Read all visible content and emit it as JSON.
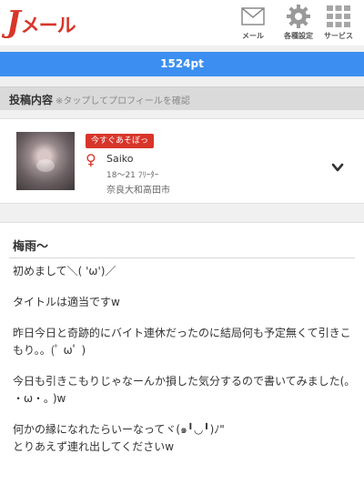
{
  "header": {
    "logo_j": "J",
    "logo_rest": "メール",
    "nav": [
      {
        "label": "メール",
        "icon": "mail-icon"
      },
      {
        "label": "各種設定",
        "icon": "gear-icon"
      },
      {
        "label": "サービス",
        "icon": "grid-icon"
      }
    ]
  },
  "points": "1524pt",
  "section": {
    "title": "投稿内容",
    "note": "※タップしてプロフィールを確認"
  },
  "profile": {
    "badge": "今すぐあそぼっ",
    "gender_symbol": "♀",
    "name": "Saiko",
    "age": "18〜21 ﾌﾘｰﾀｰ",
    "location": "奈良大和高田市"
  },
  "post": {
    "title": "梅雨〜",
    "paragraphs": [
      "初めまして＼( 'ω')／",
      "タイトルは適当ですw",
      "昨日今日と奇跡的にバイト連休だったのに結局何も予定無くて引きこもり。。(ﾟ ωﾟ )",
      "今日も引きこもりじゃなーんか損した気分するので書いてみました(｡ ・ω・｡ )w",
      "何かの縁になれたらいーなってヾ(๑╹◡╹)ﾉ\"\nとりあえず連れ出してくださいw"
    ]
  },
  "colors": {
    "brand_red": "#d8352a",
    "points_blue": "#3c8ff0"
  }
}
